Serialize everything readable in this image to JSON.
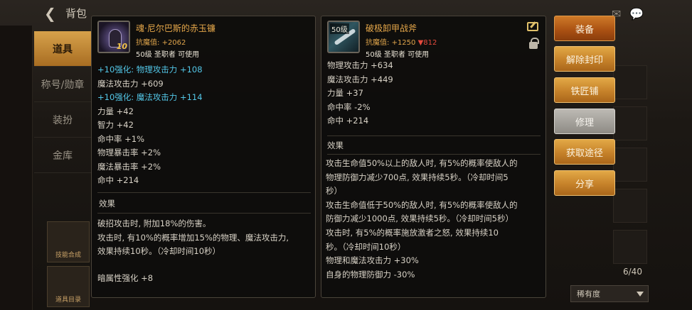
{
  "header": {
    "title": "背包"
  },
  "leftnav": {
    "items": [
      {
        "label": "道具",
        "active": true
      },
      {
        "label": "称号/勋章",
        "active": false
      },
      {
        "label": "装扮",
        "active": false
      },
      {
        "label": "金库",
        "active": false
      }
    ],
    "bottom": [
      {
        "label": "技能合成"
      },
      {
        "label": "道具目录"
      }
    ]
  },
  "left_item": {
    "name": "魂·尼尔巴斯的赤玉镰",
    "anti_label": "抗魔值:",
    "anti_value": "+2062",
    "requirement": "50级 圣职者 可使用",
    "icon_level": "10",
    "stats": [
      {
        "text": "+10强化: 物理攻击力 +108",
        "color": "cyan"
      },
      {
        "text": "魔法攻击力 +609",
        "color": "norm"
      },
      {
        "text": "+10强化: 魔法攻击力 +114",
        "color": "cyan"
      },
      {
        "text": "力量 +42",
        "color": "norm"
      },
      {
        "text": "智力 +42",
        "color": "norm"
      },
      {
        "text": "命中率 +1%",
        "color": "norm"
      },
      {
        "text": "物理暴击率 +2%",
        "color": "norm"
      },
      {
        "text": "魔法暴击率 +2%",
        "color": "norm"
      },
      {
        "text": "命中 +214",
        "color": "norm"
      }
    ],
    "effect_title": "效果",
    "effects": [
      "破招攻击时, 附加18%的伤害。",
      "攻击时, 有10%的概率增加15%的物理、魔法攻击力,",
      "效果持续10秒。（冷却时间10秒）"
    ],
    "element": "暗属性强化 +8"
  },
  "right_item": {
    "name": "破极卸甲战斧",
    "icon_level": "50级",
    "anti_label": "抗魔值:",
    "anti_value": "+1250",
    "anti_diff": "▼812",
    "requirement": "50级 圣职者 可使用",
    "stats": [
      "物理攻击力 +634",
      "魔法攻击力 +449",
      "力量 +37",
      "命中率 -2%",
      "命中 +214"
    ],
    "effect_title": "效果",
    "effects": [
      "攻击生命值50%以上的敌人时, 有5%的概率使敌人的",
      "物理防御力减少700点, 效果持续5秒。（冷却时间5",
      "秒）",
      "攻击生命值低于50%的敌人时, 有5%的概率使敌人的",
      "防御力减少1000点, 效果持续5秒。（冷却时间5秒）",
      "攻击时, 有5%的概率施放激者之怒, 效果持续10",
      "秒。（冷却时间10秒）",
      "物理和魔法攻击力 +30%",
      "自身的物理防御力 -30%"
    ]
  },
  "actions": {
    "equip": "装备",
    "unseal": "解除封印",
    "smith": "铁匠铺",
    "repair": "修理",
    "obtain": "获取途径",
    "share": "分享"
  },
  "inventory": {
    "count": "6/40",
    "sort_label": "稀有度"
  },
  "colors": {
    "accent": "#e7a84a",
    "cyan": "#53c7e8",
    "down_red": "#e54a3d",
    "button_orange": "#c6822a"
  }
}
